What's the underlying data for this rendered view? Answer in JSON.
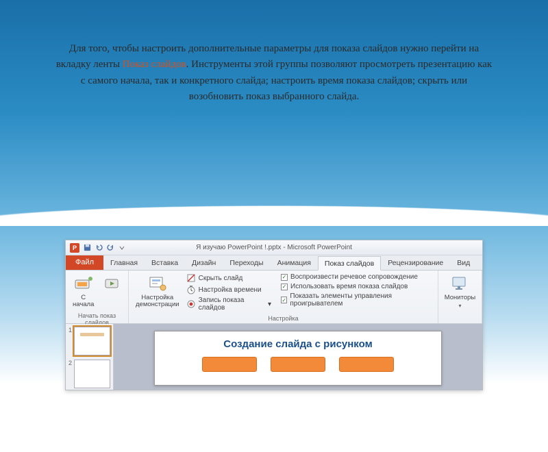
{
  "explainer": {
    "line1_pre": "Для того, чтобы настроить дополнительные параметры для показа слайдов нужно перейти на вкладку ленты ",
    "highlight": "Показ слайдов",
    "line1_post": ". Инструменты этой группы позволяют просмотреть презентацию как с самого начала, так и конкретного слайда; настроить время показа слайдов; скрыть или возобновить показ выбранного слайда."
  },
  "window": {
    "app_icon_letter": "P",
    "title": "Я изучаю PowerPoint !.pptx  -  Microsoft PowerPoint"
  },
  "tabs": {
    "file": "Файл",
    "items": [
      "Главная",
      "Вставка",
      "Дизайн",
      "Переходы",
      "Анимация",
      "Показ слайдов",
      "Рецензирование",
      "Вид"
    ],
    "active_index": 5
  },
  "ribbon": {
    "group_start": {
      "from_start_line1": "С",
      "from_start_line2": "начала",
      "label": "Начать показ слайдов"
    },
    "group_setup": {
      "setup_line1": "Настройка",
      "setup_line2": "демонстрации",
      "hide_slide": "Скрыть слайд",
      "rehearse": "Настройка времени",
      "record": "Запись показа слайдов",
      "chk_narration": "Воспроизвести речевое сопровождение",
      "chk_timings": "Использовать время показа слайдов",
      "chk_controls": "Показать элементы управления проигрывателем",
      "label": "Настройка"
    },
    "group_monitors": {
      "monitors": "Мониторы"
    }
  },
  "slide": {
    "title": "Создание слайда с рисунком"
  },
  "thumbs": {
    "n1": "1",
    "n2": "2"
  }
}
